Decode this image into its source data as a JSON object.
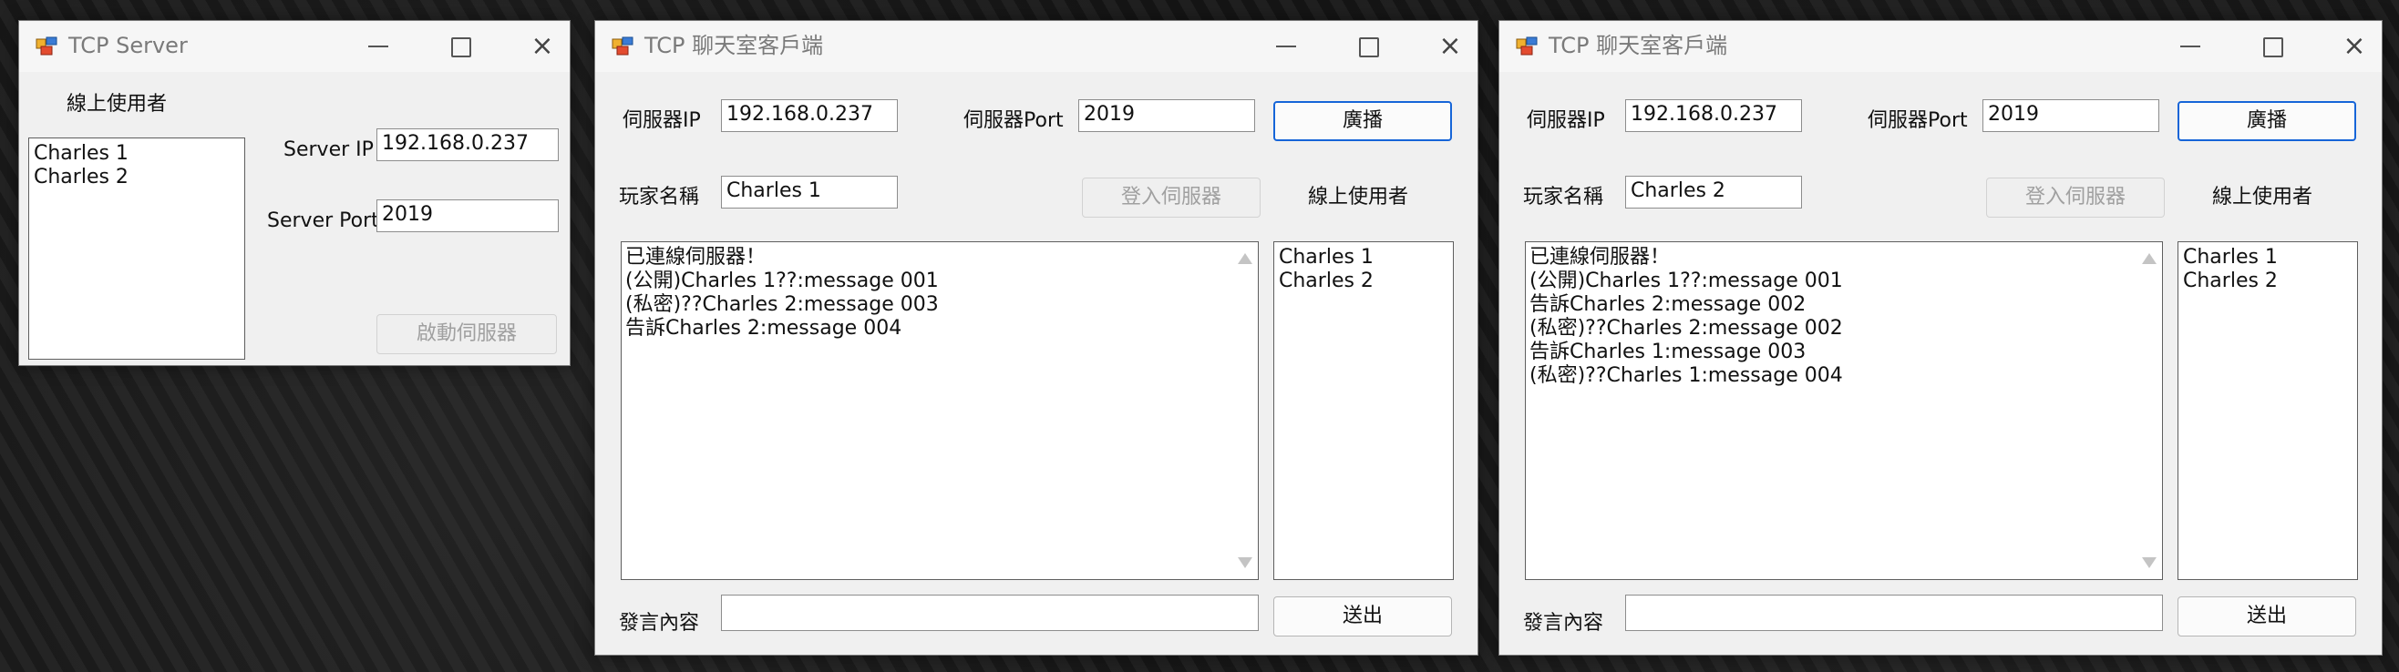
{
  "server": {
    "title": "TCP Server",
    "online_label": "線上使用者",
    "users": [
      "Charles 1",
      "Charles 2"
    ],
    "server_ip_label": "Server IP",
    "server_ip": "192.168.0.237",
    "server_port_label": "Server Port",
    "server_port": "2019",
    "start_button": "啟動伺服器"
  },
  "client1": {
    "title": "TCP 聊天室客戶端",
    "server_ip_label": "伺服器IP",
    "server_ip": "192.168.0.237",
    "server_port_label": "伺服器Port",
    "server_port": "2019",
    "broadcast_button": "廣播",
    "player_name_label": "玩家名稱",
    "player_name": "Charles 1",
    "login_button": "登入伺服器",
    "online_label": "線上使用者",
    "messages": [
      "已連線伺服器！",
      "(公開)Charles 1??:message 001",
      "(私密)??Charles 2:message 003",
      "告訴Charles 2:message 004"
    ],
    "users": [
      "Charles 1",
      "Charles 2"
    ],
    "message_label": "發言內容",
    "message_input": "",
    "send_button": "送出"
  },
  "client2": {
    "title": "TCP 聊天室客戶端",
    "server_ip_label": "伺服器IP",
    "server_ip": "192.168.0.237",
    "server_port_label": "伺服器Port",
    "server_port": "2019",
    "broadcast_button": "廣播",
    "player_name_label": "玩家名稱",
    "player_name": "Charles 2",
    "login_button": "登入伺服器",
    "online_label": "線上使用者",
    "messages": [
      "已連線伺服器！",
      "(公開)Charles 1??:message 001",
      "告訴Charles 2:message 002",
      "(私密)??Charles 2:message 002",
      "告訴Charles 1:message 003",
      "(私密)??Charles 1:message 004"
    ],
    "users": [
      "Charles 1",
      "Charles 2"
    ],
    "message_label": "發言內容",
    "message_input": "",
    "send_button": "送出"
  },
  "colors": {
    "accent": "#1665d8",
    "window_bg": "#f0f0f0",
    "disabled_text": "#a0a0a0"
  },
  "icons": [
    "app-icon",
    "minimize-icon",
    "maximize-icon",
    "close-icon",
    "scroll-up-icon",
    "scroll-down-icon"
  ]
}
